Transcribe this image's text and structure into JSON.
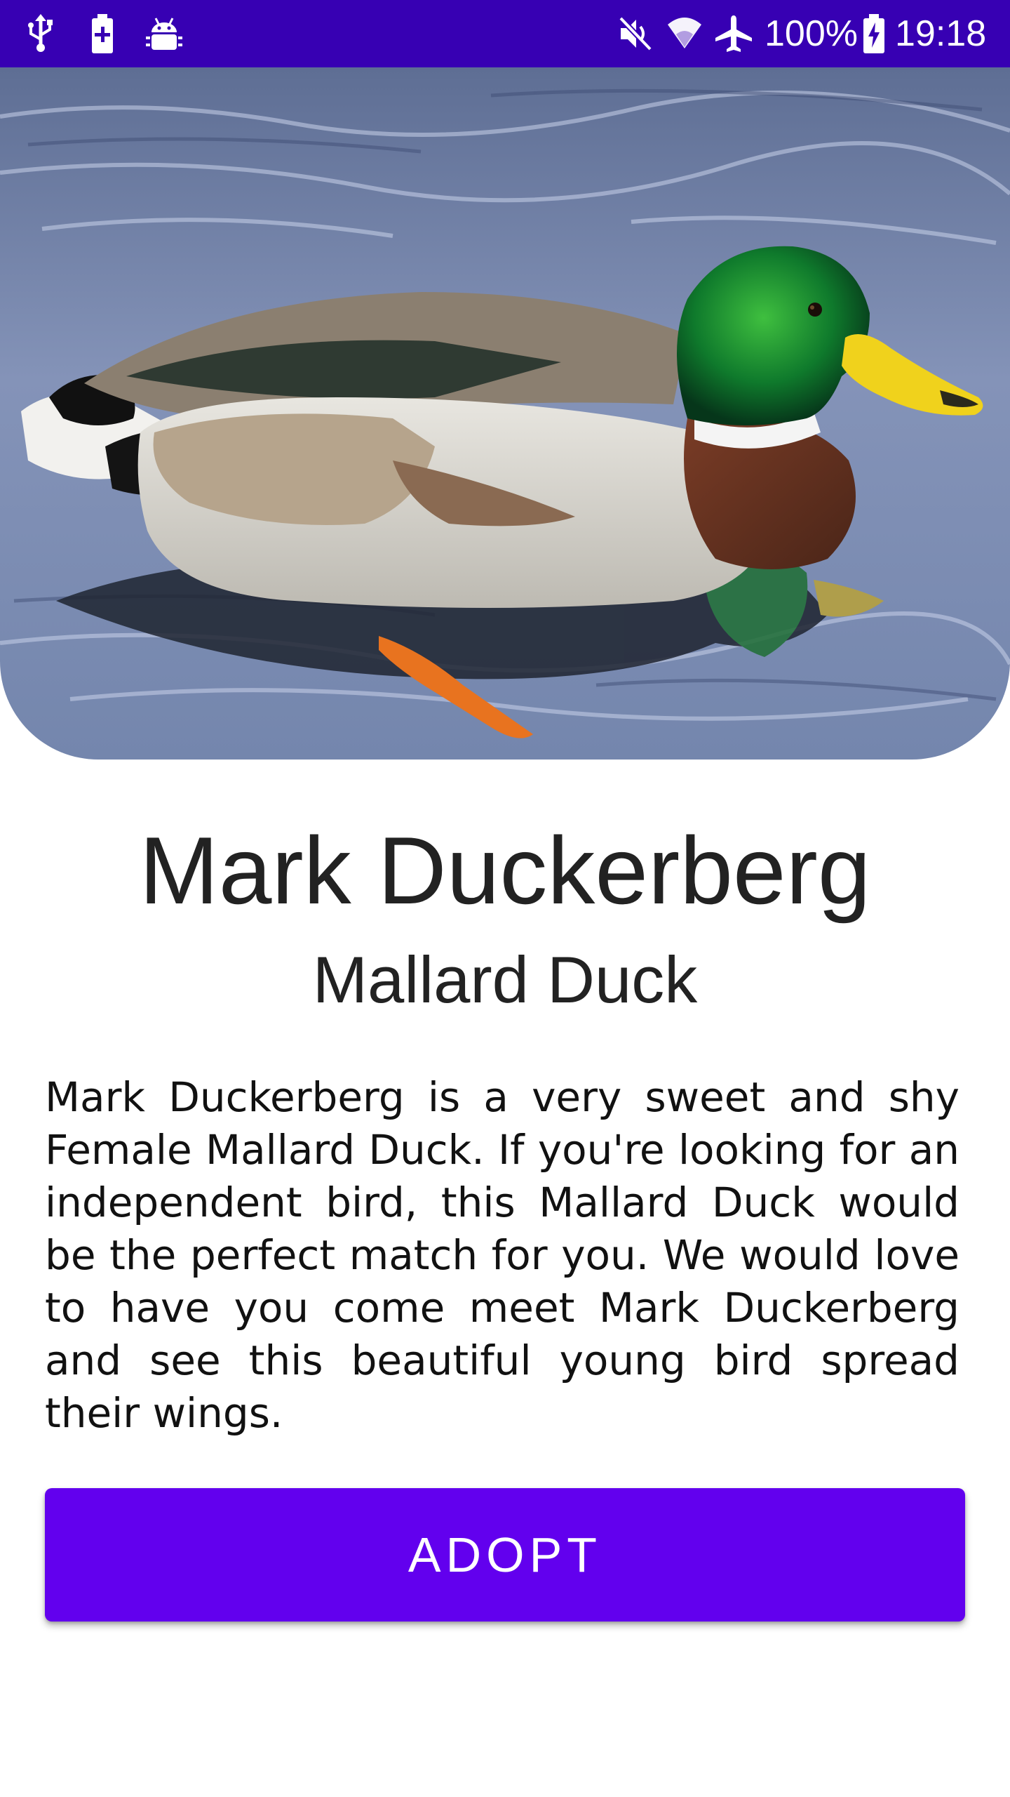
{
  "status_bar": {
    "icons_left": [
      "usb-icon",
      "battery-saver-icon",
      "android-debug-icon"
    ],
    "icons_right": [
      "vibrate-mute-icon",
      "wifi-icon",
      "airplane-mode-icon",
      "battery-icon"
    ],
    "battery_percent": "100%",
    "time": "19:18",
    "background_color": "#3700b3"
  },
  "hero_image": {
    "subject": "mallard-duck-photo"
  },
  "pet": {
    "name": "Mark Duckerberg",
    "breed": "Mallard Duck",
    "description": "Mark Duckerberg is a very sweet and shy Female Mallard Duck. If you're looking for an independent bird, this Mallard Duck would be the perfect match for you. We would love to have you come meet Mark Duckerberg and see this beautiful young bird spread their wings."
  },
  "actions": {
    "adopt_label": "ADOPT",
    "adopt_color": "#6200ee"
  }
}
